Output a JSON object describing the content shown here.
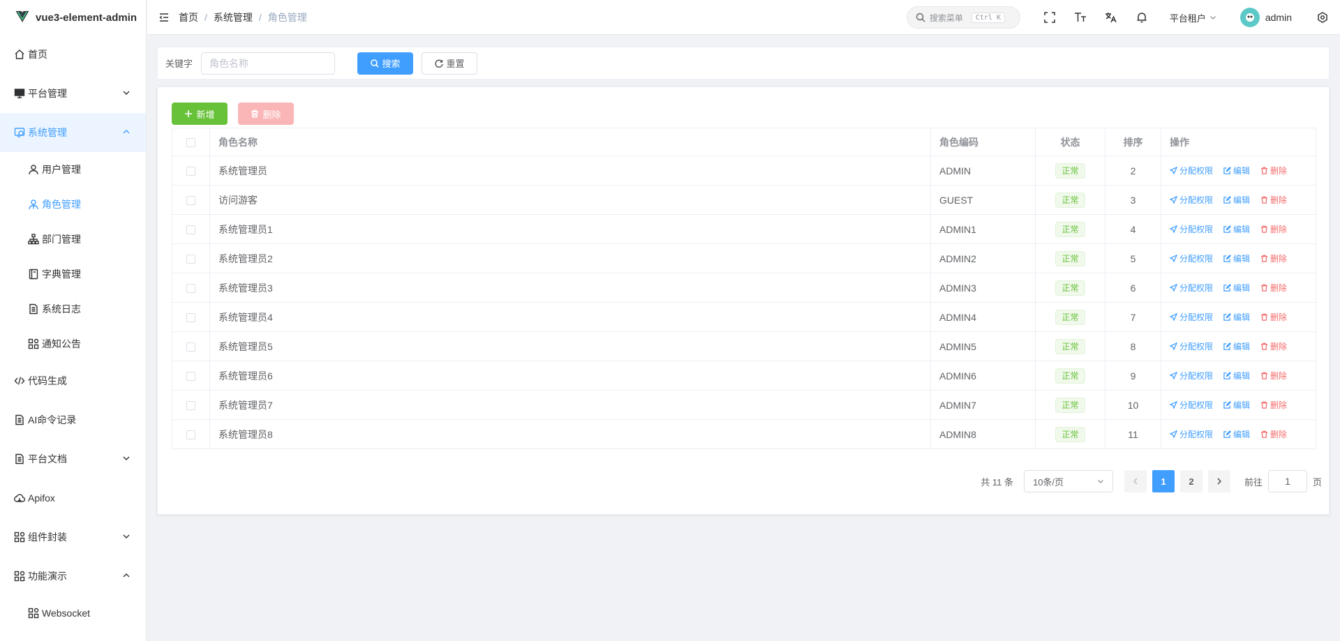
{
  "app": {
    "logo_text": "vue3-element-admin"
  },
  "sidebar": {
    "items": [
      {
        "label": "首页",
        "icon": "home-icon"
      },
      {
        "label": "平台管理",
        "icon": "monitor-icon",
        "expandable": true,
        "open": false
      },
      {
        "label": "系统管理",
        "icon": "system-icon",
        "expandable": true,
        "open": true
      },
      {
        "label": "用户管理",
        "icon": "user-icon",
        "sub": true
      },
      {
        "label": "角色管理",
        "icon": "role-icon",
        "sub": true,
        "active": true
      },
      {
        "label": "部门管理",
        "icon": "tree-icon",
        "sub": true
      },
      {
        "label": "字典管理",
        "icon": "dict-icon",
        "sub": true
      },
      {
        "label": "系统日志",
        "icon": "document-icon",
        "sub": true
      },
      {
        "label": "通知公告",
        "icon": "grid-icon",
        "sub": true
      },
      {
        "label": "代码生成",
        "icon": "code-icon"
      },
      {
        "label": "AI命令记录",
        "icon": "document-icon"
      },
      {
        "label": "平台文档",
        "icon": "document-icon",
        "expandable": true,
        "open": false
      },
      {
        "label": "Apifox",
        "icon": "cloud-icon"
      },
      {
        "label": "组件封装",
        "icon": "grid-icon",
        "expandable": true,
        "open": false
      },
      {
        "label": "功能演示",
        "icon": "grid-icon",
        "expandable": true,
        "open": true
      },
      {
        "label": "Websocket",
        "icon": "grid-icon",
        "sub": true
      }
    ]
  },
  "header": {
    "breadcrumb": [
      "首页",
      "系统管理",
      "角色管理"
    ],
    "search_placeholder": "搜索菜单",
    "search_shortcut": "Ctrl K",
    "tenant": "平台租户",
    "username": "admin"
  },
  "search": {
    "keyword_label": "关键字",
    "keyword_placeholder": "角色名称",
    "keyword_value": "",
    "search_label": "搜索",
    "reset_label": "重置"
  },
  "toolbar": {
    "add_label": "新增",
    "delete_label": "删除"
  },
  "table": {
    "columns": [
      "角色名称",
      "角色编码",
      "状态",
      "排序",
      "操作"
    ],
    "rows": [
      {
        "name": "系统管理员",
        "code": "ADMIN",
        "status": "正常",
        "sort": "2"
      },
      {
        "name": "访问游客",
        "code": "GUEST",
        "status": "正常",
        "sort": "3"
      },
      {
        "name": "系统管理员1",
        "code": "ADMIN1",
        "status": "正常",
        "sort": "4"
      },
      {
        "name": "系统管理员2",
        "code": "ADMIN2",
        "status": "正常",
        "sort": "5"
      },
      {
        "name": "系统管理员3",
        "code": "ADMIN3",
        "status": "正常",
        "sort": "6"
      },
      {
        "name": "系统管理员4",
        "code": "ADMIN4",
        "status": "正常",
        "sort": "7"
      },
      {
        "name": "系统管理员5",
        "code": "ADMIN5",
        "status": "正常",
        "sort": "8"
      },
      {
        "name": "系统管理员6",
        "code": "ADMIN6",
        "status": "正常",
        "sort": "9"
      },
      {
        "name": "系统管理员7",
        "code": "ADMIN7",
        "status": "正常",
        "sort": "10"
      },
      {
        "name": "系统管理员8",
        "code": "ADMIN8",
        "status": "正常",
        "sort": "11"
      }
    ],
    "actions": {
      "assign": "分配权限",
      "edit": "编辑",
      "delete": "删除"
    }
  },
  "pagination": {
    "total_text": "共 11 条",
    "page_size": "10条/页",
    "pages": [
      "1",
      "2"
    ],
    "current_page": "1",
    "goto_label": "前往",
    "goto_value": "1",
    "page_suffix": "页"
  },
  "colors": {
    "primary": "#409eff",
    "success": "#67c23a",
    "danger": "#f56c6c"
  }
}
